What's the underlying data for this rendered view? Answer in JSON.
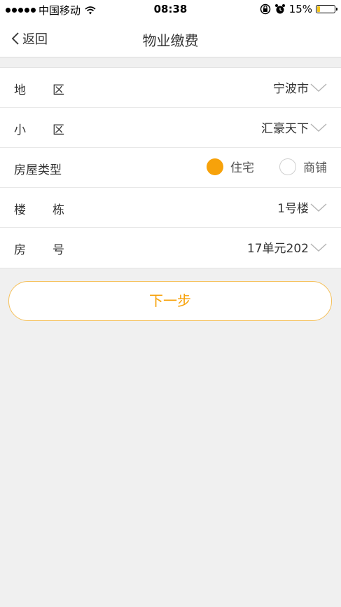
{
  "status_bar": {
    "carrier": "中国移动",
    "time": "08:38",
    "battery_percent": "15%",
    "battery_level": 0.15,
    "icons": [
      "signal-dots-icon",
      "wifi-icon",
      "orientation-lock-icon",
      "alarm-icon",
      "battery-icon"
    ]
  },
  "nav": {
    "back_label": "返回",
    "title": "物业缴费"
  },
  "form": {
    "region": {
      "label": "地区",
      "value": "宁波市"
    },
    "community": {
      "label": "小区",
      "value": "汇豪天下"
    },
    "house_type": {
      "label": "房屋类型",
      "options": [
        {
          "label": "住宅",
          "selected": true
        },
        {
          "label": "商铺",
          "selected": false
        }
      ]
    },
    "building": {
      "label": "楼栋",
      "value": "1号楼"
    },
    "room": {
      "label": "房号",
      "value": "17单元202"
    }
  },
  "next_button": {
    "label": "下一步"
  },
  "colors": {
    "accent": "#f7a20a",
    "button_border": "#f5c05a",
    "background": "#f0f0f0",
    "chevron": "#b5b5b5"
  }
}
